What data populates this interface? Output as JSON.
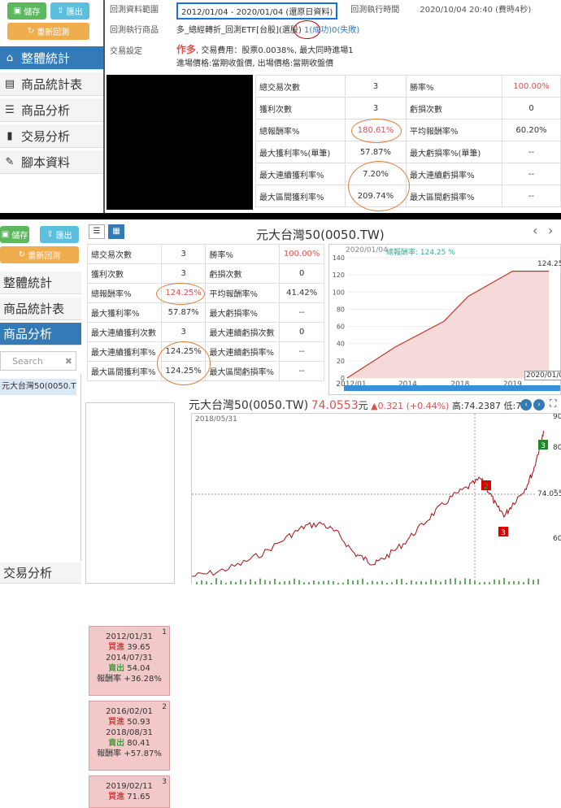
{
  "top": {
    "buttons": {
      "save": "儲存",
      "export": "匯出",
      "rerun": "重新回測"
    },
    "nav": [
      "整體統計",
      "商品統計表",
      "商品分析",
      "交易分析",
      "腳本資料"
    ],
    "info": {
      "range_label": "回測資料範圍",
      "range_value": "2012/01/04 - 2020/01/04 (還原日資料)",
      "exec_time_label": "回測執行時間",
      "exec_time_value": "2020/10/04 20:40 (費時4秒)",
      "product_label": "回測執行商品",
      "product_value": "多_總經轉折_回測ETF[台股](選股)",
      "success": "1(成功)",
      "fail": "0(失敗)",
      "setting_label": "交易設定",
      "setting_bold": "作多",
      "setting_line1": ", 交易費用：股票0.0038%, 最大同時進場1",
      "setting_line2": "進場價格:當期收盤價, 出場價格:當期收盤價"
    },
    "stats": [
      [
        "總交易次數",
        "3",
        "勝率%",
        "100.00%"
      ],
      [
        "獲利次數",
        "3",
        "虧損次數",
        "0"
      ],
      [
        "總報酬率%",
        "180.61%",
        "平均報酬率%",
        "60.20%"
      ],
      [
        "最大獲利率%(單筆)",
        "57.87%",
        "最大虧損率%(單筆)",
        "--"
      ],
      [
        "最大連續獲利率%",
        "7.20%",
        "最大連續虧損率%",
        "--"
      ],
      [
        "最大區間獲利率%",
        "209.74%",
        "最大區間虧損率%",
        "--"
      ]
    ]
  },
  "bottom": {
    "buttons": {
      "save": "儲存",
      "export": "匯出",
      "rerun": "重新回測"
    },
    "nav": [
      "整體統計",
      "商品統計表",
      "商品分析",
      "交易分析"
    ],
    "search_placeholder": "Search",
    "list_item": "元大台灣50(0050.TW)",
    "title": "元大台灣50(0050.TW)",
    "stats": [
      [
        "總交易次數",
        "3",
        "勝率%",
        "100.00%"
      ],
      [
        "獲利次數",
        "3",
        "虧損次數",
        "0"
      ],
      [
        "總報酬率%",
        "124.25%",
        "平均報酬率%",
        "41.42%"
      ],
      [
        "最大獲利率%",
        "57.87%",
        "最大虧損率%",
        "--"
      ],
      [
        "最大連續獲利次數",
        "3",
        "最大連續虧損次數",
        "0"
      ],
      [
        "最大連續獲利率%",
        "124.25%",
        "最大連續虧損率%",
        "--"
      ],
      [
        "最大區間獲利率%",
        "124.25%",
        "最大區間虧損率%",
        "--"
      ]
    ],
    "trades": [
      {
        "no": "1",
        "d1": "2012/01/31",
        "b_label": "買進",
        "b": "39.65",
        "d2": "2014/07/31",
        "s_label": "賣出",
        "s": "54.04",
        "r_label": "報酬率",
        "r": "+36.28%"
      },
      {
        "no": "2",
        "d1": "2016/02/01",
        "b_label": "買進",
        "b": "50.93",
        "d2": "2018/08/31",
        "s_label": "賣出",
        "s": "80.41",
        "r_label": "報酬率",
        "r": "+57.87%"
      },
      {
        "no": "3",
        "d1": "2019/02/11",
        "b_label": "買進",
        "b": "71.65",
        "d2": "",
        "s_label": "",
        "s": "",
        "r_label": "",
        "r": ""
      }
    ],
    "equity_chart": {
      "date_label": "2020/01/04",
      "metric_label": "總報酬率: 124.25 %",
      "end_label": "124.25",
      "end_date": "2020/01/04"
    },
    "price_header": {
      "name": "元大台灣50(0050.TW)",
      "price": "74.0553",
      "unit": "元",
      "change": "▲0.321 (+0.44%)",
      "high": "高:74.2387",
      "low": "低:7",
      "date": "2018/05/31",
      "price_tag": "74.0553"
    }
  },
  "chart_data": [
    {
      "type": "line",
      "x": [
        "2012/01",
        "2014",
        "2016",
        "2018",
        "2019",
        "2020"
      ],
      "series": [
        {
          "values": [
            0,
            36.28,
            66,
            95,
            124.25,
            124.25
          ]
        }
      ],
      "ylim": [
        0,
        140
      ],
      "yticks": [
        0,
        20,
        40,
        60,
        80,
        100,
        120,
        140
      ],
      "xticks": [
        "2012/01",
        "2014",
        "2018",
        "2019",
        "2020/01/04"
      ]
    },
    {
      "type": "line",
      "ylim": [
        55,
        100
      ],
      "yticks": [
        "60",
        "70",
        "80",
        "90"
      ],
      "markers": [
        {
          "label": "1",
          "type": "buy"
        },
        {
          "label": "2",
          "type": "buy"
        },
        {
          "label": "2",
          "type": "sell"
        },
        {
          "label": "3",
          "type": "buy"
        },
        {
          "label": "3",
          "type": "sell"
        }
      ]
    }
  ],
  "colors": {
    "accent": "#337ab7",
    "red": "#d9534f",
    "green": "#5cb85c"
  }
}
